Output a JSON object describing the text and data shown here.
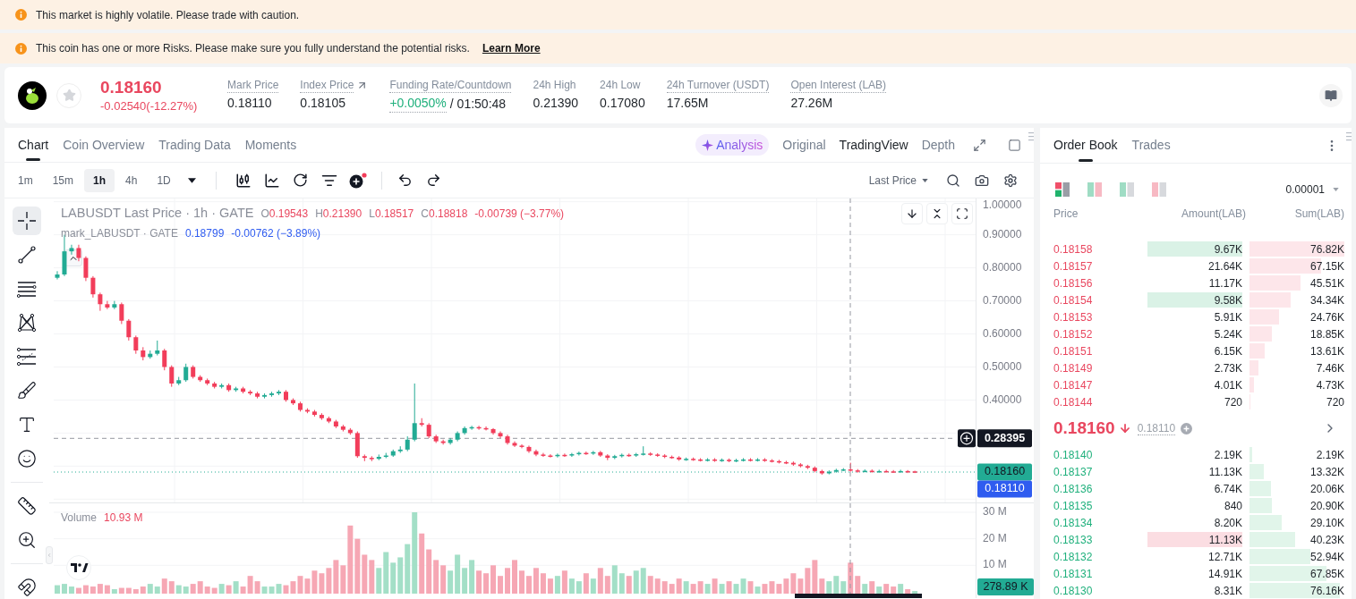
{
  "banners": [
    {
      "text": "This market is highly volatile. Please trade with caution."
    },
    {
      "text": "This coin has one or more Risks. Please make sure you fully understand the potential risks.",
      "link": "Learn More"
    }
  ],
  "ticker": {
    "favorited": false,
    "last_price": "0.18160",
    "change": "-0.02540(-12.27%)",
    "falling": true,
    "stats": [
      {
        "kind": "plain",
        "label": "Mark Price",
        "value": "0.18110",
        "dotted": true
      },
      {
        "kind": "link",
        "label": "Index Price",
        "value": "0.18105",
        "dotted": true
      },
      {
        "kind": "funding",
        "label": "Funding Rate/Countdown",
        "value": "+0.0050%",
        "countdown": "/ 01:50:48",
        "dotted": true
      },
      {
        "kind": "plain",
        "label": "24h High",
        "value": "0.21390",
        "dotted": false
      },
      {
        "kind": "plain",
        "label": "24h Low",
        "value": "0.17080",
        "dotted": false
      },
      {
        "kind": "plain",
        "label": "24h Turnover (USDT)",
        "value": "17.65M",
        "dotted": true
      },
      {
        "kind": "plain",
        "label": "Open Interest (LAB)",
        "value": "27.26M",
        "dotted": true
      }
    ]
  },
  "chart_panel": {
    "tabs": [
      {
        "label": "Chart",
        "selected": true
      },
      {
        "label": "Coin Overview",
        "selected": false
      },
      {
        "label": "Trading Data",
        "selected": false
      },
      {
        "label": "Moments",
        "selected": false
      }
    ],
    "views": [
      {
        "kind": "ai",
        "label": "Analysis",
        "selected": false
      },
      {
        "kind": "plain",
        "label": "Original",
        "selected": false
      },
      {
        "kind": "plain",
        "label": "TradingView",
        "selected": true
      },
      {
        "kind": "plain",
        "label": "Depth",
        "selected": false
      }
    ],
    "intervals": [
      {
        "label": "1m",
        "selected": false
      },
      {
        "label": "15m",
        "selected": false
      },
      {
        "label": "1h",
        "selected": true
      },
      {
        "label": "4h",
        "selected": false
      },
      {
        "label": "1D",
        "selected": false
      }
    ],
    "price_source": "Last Price",
    "tool_groups": [
      [
        {
          "kind": "crosshair",
          "selected": true
        },
        {
          "kind": "trend-line",
          "selected": false
        },
        {
          "kind": "horizontal-lines",
          "selected": false
        },
        {
          "kind": "pattern",
          "selected": false
        },
        {
          "kind": "levels",
          "selected": false
        },
        {
          "kind": "brush",
          "selected": false
        },
        {
          "kind": "text",
          "selected": false
        },
        {
          "kind": "emoji",
          "selected": false
        }
      ],
      [
        {
          "kind": "ruler",
          "selected": false
        },
        {
          "kind": "zoom",
          "selected": false
        }
      ],
      [
        {
          "kind": "magnet",
          "selected": false
        }
      ]
    ],
    "legend": {
      "title": "LABUSDT Last Price · 1h · GATE",
      "ohlc": [
        {
          "key": "O",
          "value": "0.19543"
        },
        {
          "key": "H",
          "value": "0.21390"
        },
        {
          "key": "L",
          "value": "0.18517"
        },
        {
          "key": "C",
          "value": "0.18818"
        }
      ],
      "change": "-0.00739 (−3.77%)"
    },
    "mark_legend": {
      "title": "mark_LABUSDT · GATE",
      "value": "0.18799",
      "change": "-0.00762 (−3.89%)"
    },
    "price_pane": {
      "crosshair_price": "0.28395",
      "last_price": "0.18160",
      "mark_price": "0.18110",
      "chart_data": {
        "type": "candlestick",
        "grid": true,
        "ylim": [
          0.09,
          1.01
        ],
        "yticks": [
          {
            "value": 0.4,
            "label": "0.40000"
          },
          {
            "value": 0.5,
            "label": "0.50000"
          },
          {
            "value": 0.6,
            "label": "0.60000"
          },
          {
            "value": 0.7,
            "label": "0.70000"
          },
          {
            "value": 0.8,
            "label": "0.80000"
          },
          {
            "value": 0.9,
            "label": "0.90000"
          },
          {
            "value": 1.0,
            "label": "1.00000"
          }
        ],
        "categories": [
          null,
          null,
          null,
          null,
          null,
          null,
          null,
          null,
          null,
          null,
          null,
          null,
          null,
          null,
          null,
          null,
          null,
          null,
          null,
          null,
          null,
          null,
          null,
          null,
          null,
          null,
          null,
          null,
          null,
          null,
          null,
          null,
          null,
          null,
          null,
          null,
          null,
          null,
          null,
          null,
          null,
          null,
          null,
          null,
          null,
          null,
          null,
          null,
          null,
          null,
          null,
          null,
          null,
          null,
          null,
          null,
          null,
          null,
          null,
          null,
          null,
          null,
          null,
          null,
          null,
          null,
          null,
          null,
          null,
          null,
          null,
          null,
          null,
          null,
          null,
          null,
          null,
          null,
          null,
          null,
          null,
          null,
          null,
          null,
          null,
          null,
          null,
          null,
          null,
          null,
          null,
          null,
          null,
          null,
          null,
          null,
          null,
          null,
          null,
          null,
          null,
          null,
          null,
          null,
          null,
          null,
          null,
          null,
          null,
          null,
          null,
          null,
          null,
          null,
          null,
          null,
          null,
          null,
          null,
          null,
          null,
          null,
          null,
          null,
          null,
          null,
          null,
          null,
          null
        ],
        "ohlc": [
          [
            0.77,
            0.79,
            0.765,
            0.78
          ],
          [
            0.78,
            0.9,
            0.775,
            0.85
          ],
          [
            0.85,
            0.87,
            0.84,
            0.86
          ],
          [
            0.86,
            0.87,
            0.82,
            0.83
          ],
          [
            0.83,
            0.835,
            0.76,
            0.77
          ],
          [
            0.77,
            0.775,
            0.71,
            0.72
          ],
          [
            0.72,
            0.725,
            0.67,
            0.69
          ],
          [
            0.69,
            0.7,
            0.675,
            0.68
          ],
          [
            0.68,
            0.7,
            0.675,
            0.69
          ],
          [
            0.69,
            0.695,
            0.63,
            0.64
          ],
          [
            0.64,
            0.645,
            0.58,
            0.59
          ],
          [
            0.59,
            0.595,
            0.54,
            0.55
          ],
          [
            0.55,
            0.56,
            0.52,
            0.53
          ],
          [
            0.53,
            0.55,
            0.525,
            0.54
          ],
          [
            0.54,
            0.58,
            0.535,
            0.55
          ],
          [
            0.55,
            0.555,
            0.49,
            0.5
          ],
          [
            0.5,
            0.505,
            0.44,
            0.45
          ],
          [
            0.45,
            0.47,
            0.445,
            0.46
          ],
          [
            0.46,
            0.51,
            0.455,
            0.5
          ],
          [
            0.5,
            0.505,
            0.465,
            0.47
          ],
          [
            0.47,
            0.475,
            0.455,
            0.46
          ],
          [
            0.46,
            0.465,
            0.445,
            0.45
          ],
          [
            0.45,
            0.455,
            0.435,
            0.44
          ],
          [
            0.44,
            0.45,
            0.435,
            0.445
          ],
          [
            0.445,
            0.45,
            0.425,
            0.43
          ],
          [
            0.43,
            0.44,
            0.425,
            0.435
          ],
          [
            0.435,
            0.44,
            0.42,
            0.425
          ],
          [
            0.425,
            0.43,
            0.415,
            0.42
          ],
          [
            0.42,
            0.425,
            0.405,
            0.41
          ],
          [
            0.41,
            0.42,
            0.405,
            0.415
          ],
          [
            0.415,
            0.425,
            0.41,
            0.42
          ],
          [
            0.42,
            0.43,
            0.415,
            0.425
          ],
          [
            0.425,
            0.43,
            0.395,
            0.4
          ],
          [
            0.4,
            0.405,
            0.385,
            0.39
          ],
          [
            0.39,
            0.395,
            0.365,
            0.37
          ],
          [
            0.37,
            0.375,
            0.36,
            0.365
          ],
          [
            0.365,
            0.37,
            0.35,
            0.355
          ],
          [
            0.355,
            0.36,
            0.34,
            0.345
          ],
          [
            0.345,
            0.35,
            0.33,
            0.335
          ],
          [
            0.335,
            0.34,
            0.315,
            0.32
          ],
          [
            0.32,
            0.325,
            0.305,
            0.31
          ],
          [
            0.31,
            0.315,
            0.295,
            0.3
          ],
          [
            0.3,
            0.305,
            0.225,
            0.23
          ],
          [
            0.23,
            0.235,
            0.215,
            0.225
          ],
          [
            0.225,
            0.23,
            0.215,
            0.222
          ],
          [
            0.222,
            0.235,
            0.218,
            0.228
          ],
          [
            0.228,
            0.24,
            0.224,
            0.232
          ],
          [
            0.232,
            0.25,
            0.228,
            0.245
          ],
          [
            0.245,
            0.26,
            0.24,
            0.25
          ],
          [
            0.25,
            0.29,
            0.245,
            0.28
          ],
          [
            0.28,
            0.45,
            0.275,
            0.33
          ],
          [
            0.33,
            0.345,
            0.32,
            0.325
          ],
          [
            0.325,
            0.33,
            0.285,
            0.29
          ],
          [
            0.29,
            0.295,
            0.27,
            0.275
          ],
          [
            0.275,
            0.28,
            0.265,
            0.27
          ],
          [
            0.27,
            0.285,
            0.265,
            0.28
          ],
          [
            0.28,
            0.305,
            0.275,
            0.3
          ],
          [
            0.3,
            0.32,
            0.295,
            0.315
          ],
          [
            0.315,
            0.322,
            0.31,
            0.318
          ],
          [
            0.318,
            0.322,
            0.31,
            0.315
          ],
          [
            0.315,
            0.32,
            0.308,
            0.312
          ],
          [
            0.312,
            0.315,
            0.295,
            0.3
          ],
          [
            0.3,
            0.305,
            0.285,
            0.29
          ],
          [
            0.29,
            0.295,
            0.265,
            0.27
          ],
          [
            0.27,
            0.275,
            0.258,
            0.262
          ],
          [
            0.262,
            0.266,
            0.254,
            0.258
          ],
          [
            0.258,
            0.262,
            0.24,
            0.245
          ],
          [
            0.245,
            0.25,
            0.23,
            0.235
          ],
          [
            0.235,
            0.24,
            0.228,
            0.232
          ],
          [
            0.232,
            0.236,
            0.226,
            0.23
          ],
          [
            0.23,
            0.238,
            0.226,
            0.234
          ],
          [
            0.234,
            0.238,
            0.228,
            0.232
          ],
          [
            0.232,
            0.24,
            0.228,
            0.236
          ],
          [
            0.236,
            0.244,
            0.232,
            0.24
          ],
          [
            0.24,
            0.244,
            0.234,
            0.238
          ],
          [
            0.238,
            0.246,
            0.234,
            0.242
          ],
          [
            0.242,
            0.246,
            0.228,
            0.232
          ],
          [
            0.232,
            0.236,
            0.218,
            0.225
          ],
          [
            0.225,
            0.234,
            0.221,
            0.23
          ],
          [
            0.23,
            0.238,
            0.226,
            0.234
          ],
          [
            0.234,
            0.238,
            0.228,
            0.232
          ],
          [
            0.232,
            0.24,
            0.228,
            0.236
          ],
          [
            0.236,
            0.26,
            0.232,
            0.238
          ],
          [
            0.238,
            0.242,
            0.231,
            0.235
          ],
          [
            0.235,
            0.239,
            0.228,
            0.232
          ],
          [
            0.232,
            0.236,
            0.224,
            0.228
          ],
          [
            0.228,
            0.232,
            0.222,
            0.226
          ],
          [
            0.226,
            0.23,
            0.216,
            0.22
          ],
          [
            0.22,
            0.226,
            0.216,
            0.222
          ],
          [
            0.222,
            0.226,
            0.216,
            0.22
          ],
          [
            0.22,
            0.224,
            0.214,
            0.218
          ],
          [
            0.218,
            0.224,
            0.214,
            0.22
          ],
          [
            0.22,
            0.224,
            0.213,
            0.217
          ],
          [
            0.217,
            0.223,
            0.213,
            0.219
          ],
          [
            0.219,
            0.223,
            0.212,
            0.216
          ],
          [
            0.216,
            0.222,
            0.212,
            0.218
          ],
          [
            0.218,
            0.224,
            0.214,
            0.22
          ],
          [
            0.22,
            0.224,
            0.214,
            0.218
          ],
          [
            0.218,
            0.224,
            0.214,
            0.22
          ],
          [
            0.22,
            0.224,
            0.213,
            0.217
          ],
          [
            0.217,
            0.221,
            0.211,
            0.215
          ],
          [
            0.215,
            0.219,
            0.208,
            0.212
          ],
          [
            0.212,
            0.216,
            0.206,
            0.21
          ],
          [
            0.21,
            0.214,
            0.201,
            0.205
          ],
          [
            0.205,
            0.209,
            0.196,
            0.2
          ],
          [
            0.2,
            0.204,
            0.191,
            0.195
          ],
          [
            0.195,
            0.199,
            0.181,
            0.185
          ],
          [
            0.185,
            0.189,
            0.174,
            0.178
          ],
          [
            0.178,
            0.187,
            0.175,
            0.183
          ],
          [
            0.183,
            0.192,
            0.18,
            0.188
          ],
          [
            0.188,
            0.194,
            0.185,
            0.19
          ],
          [
            0.19,
            0.21,
            0.183,
            0.187
          ],
          [
            0.187,
            0.191,
            0.18,
            0.184
          ],
          [
            0.184,
            0.19,
            0.181,
            0.186
          ],
          [
            0.186,
            0.19,
            0.18,
            0.183
          ],
          [
            0.183,
            0.189,
            0.18,
            0.185
          ],
          [
            0.185,
            0.189,
            0.181,
            0.184
          ],
          [
            0.184,
            0.188,
            0.18,
            0.183
          ],
          [
            0.183,
            0.189,
            0.18,
            0.185
          ],
          [
            0.185,
            0.188,
            0.179,
            0.182
          ],
          [
            0.184,
            0.186,
            0.179,
            0.182
          ],
          null,
          null,
          null,
          null,
          null,
          null,
          null,
          null
        ],
        "ref_lines": [
          {
            "axis": "y",
            "value": 0.182,
            "color": "#22ab94"
          },
          {
            "axis": "y",
            "value": 0.284,
            "color": "#9598a1"
          }
        ]
      }
    },
    "volume_pane": {
      "label": "Volume",
      "value": "10.93 M",
      "current": "278.89 K",
      "chart_data": {
        "type": "bar",
        "stacked": true,
        "grid": true,
        "ylim": [
          0,
          33.7
        ],
        "yticks": [
          {
            "value": 10,
            "label": "10 M"
          },
          {
            "value": 20,
            "label": "20 M"
          },
          {
            "value": 30,
            "label": "30 M"
          }
        ],
        "categories": [
          null,
          null,
          null,
          null,
          null,
          null,
          null,
          null,
          null,
          null,
          null,
          null,
          null,
          null,
          null,
          null,
          null,
          null,
          null,
          null,
          null,
          null,
          null,
          null,
          null,
          null,
          null,
          null,
          null,
          null,
          null,
          null,
          null,
          null,
          null,
          null,
          null,
          null,
          null,
          null,
          null,
          null,
          null,
          null,
          null,
          null,
          null,
          null,
          null,
          null,
          null,
          null,
          null,
          null,
          null,
          null,
          null,
          null,
          null,
          null,
          null,
          null,
          null,
          null,
          null,
          null,
          null,
          null,
          null,
          null,
          null,
          null,
          null,
          null,
          null,
          null,
          null,
          null,
          null,
          null,
          null,
          null,
          null,
          null,
          null,
          null,
          null,
          null,
          null,
          null,
          null,
          null,
          null,
          null,
          null,
          null,
          null,
          null,
          null,
          null,
          null,
          null,
          null,
          null,
          null,
          null,
          null,
          null,
          null,
          null,
          null,
          null,
          null,
          null,
          null,
          null,
          null,
          null,
          null,
          null,
          null,
          null,
          null,
          null,
          null,
          null,
          null,
          null,
          null
        ],
        "series": [
          {
            "color": "#a3dfc7",
            "values": [
              2.5,
              3,
              2,
              null,
              null,
              null,
              null,
              null,
              1,
              null,
              null,
              null,
              null,
              3,
              2,
              null,
              null,
              2.5,
              2,
              null,
              null,
              null,
              null,
              3,
              null,
              4,
              null,
              null,
              null,
              2,
              2,
              3,
              null,
              null,
              null,
              null,
              null,
              null,
              null,
              null,
              null,
              null,
              null,
              null,
              null,
              9,
              15,
              11,
              13,
              18,
              30,
              null,
              null,
              null,
              null,
              8,
              14,
              9,
              12,
              null,
              null,
              null,
              null,
              null,
              null,
              null,
              null,
              null,
              null,
              null,
              6,
              null,
              5,
              4,
              null,
              5,
              null,
              null,
              10,
              7,
              null,
              8,
              9,
              null,
              null,
              null,
              null,
              null,
              4,
              null,
              null,
              3,
              null,
              3,
              null,
              3,
              5,
              null,
              2,
              null,
              null,
              null,
              null,
              null,
              null,
              null,
              null,
              null,
              4,
              6,
              4,
              null,
              null,
              3,
              null,
              2,
              null,
              null,
              3,
              null,
              0.3,
              null,
              null,
              null,
              null,
              null,
              null,
              null,
              null
            ]
          },
          {
            "color": "#f6a7b4",
            "values": [
              null,
              null,
              null,
              1.5,
              2.5,
              2,
              3,
              2.5,
              null,
              1.5,
              1.5,
              1,
              2,
              null,
              null,
              5,
              4,
              null,
              null,
              3,
              4,
              2,
              1.5,
              null,
              2.5,
              null,
              2,
              6,
              4,
              null,
              null,
              null,
              2.5,
              4,
              6,
              5,
              8,
              7,
              9,
              12,
              10,
              25,
              20,
              14,
              12,
              null,
              null,
              null,
              null,
              null,
              null,
              22,
              16,
              12,
              10,
              null,
              null,
              null,
              null,
              8,
              7,
              10,
              6,
              9,
              12,
              8,
              6,
              9,
              7,
              5,
              null,
              8,
              null,
              null,
              7,
              null,
              9,
              6,
              null,
              null,
              6,
              null,
              null,
              6,
              5,
              4,
              3,
              5,
              null,
              3,
              4,
              null,
              5,
              null,
              4,
              null,
              null,
              4,
              null,
              3,
              4,
              3,
              5,
              7,
              5,
              9,
              12,
              5,
              null,
              null,
              null,
              11,
              6,
              null,
              4,
              null,
              3,
              2,
              null,
              1,
              null,
              null,
              null,
              null,
              null,
              null,
              null,
              null,
              null
            ]
          }
        ]
      }
    }
  },
  "order_book": {
    "tabs": [
      {
        "label": "Order Book",
        "selected": true
      },
      {
        "label": "Trades",
        "selected": false
      }
    ],
    "layouts": [
      {
        "kind": "split",
        "selected": true
      },
      {
        "kind": "mixed",
        "selected": false
      },
      {
        "kind": "bids",
        "selected": false
      },
      {
        "kind": "asks",
        "selected": false
      }
    ],
    "precision": "0.00001",
    "columns": [
      "Price",
      "Amount(LAB)",
      "Sum(LAB)"
    ],
    "asks": [
      {
        "price": "0.18158",
        "amount": "9.67K",
        "sum": "76.82K",
        "level": 1.0,
        "highlighted": true
      },
      {
        "price": "0.18157",
        "amount": "21.64K",
        "sum": "67.15K",
        "level": 0.75,
        "highlighted": false
      },
      {
        "price": "0.18156",
        "amount": "11.17K",
        "sum": "45.51K",
        "level": 0.54,
        "highlighted": false
      },
      {
        "price": "0.18154",
        "amount": "9.58K",
        "sum": "34.34K",
        "level": 0.43,
        "highlighted": true
      },
      {
        "price": "0.18153",
        "amount": "5.91K",
        "sum": "24.76K",
        "level": 0.31,
        "highlighted": false
      },
      {
        "price": "0.18152",
        "amount": "5.24K",
        "sum": "18.85K",
        "level": 0.24,
        "highlighted": false
      },
      {
        "price": "0.18151",
        "amount": "6.15K",
        "sum": "13.61K",
        "level": 0.16,
        "highlighted": false
      },
      {
        "price": "0.18149",
        "amount": "2.73K",
        "sum": "7.46K",
        "level": 0.09,
        "highlighted": false
      },
      {
        "price": "0.18147",
        "amount": "4.01K",
        "sum": "4.73K",
        "level": 0.05,
        "highlighted": false
      },
      {
        "price": "0.18144",
        "amount": "720",
        "sum": "720",
        "level": 0.01,
        "highlighted": false
      }
    ],
    "mid": {
      "price": "0.18160",
      "falling": true,
      "mark": "0.18110"
    },
    "bids": [
      {
        "price": "0.18140",
        "amount": "2.19K",
        "sum": "2.19K",
        "level": 0.03,
        "highlighted": false
      },
      {
        "price": "0.18137",
        "amount": "11.13K",
        "sum": "13.32K",
        "level": 0.15,
        "highlighted": false
      },
      {
        "price": "0.18136",
        "amount": "6.74K",
        "sum": "20.06K",
        "level": 0.23,
        "highlighted": false
      },
      {
        "price": "0.18135",
        "amount": "840",
        "sum": "20.90K",
        "level": 0.24,
        "highlighted": false
      },
      {
        "price": "0.18134",
        "amount": "8.20K",
        "sum": "29.10K",
        "level": 0.34,
        "highlighted": false
      },
      {
        "price": "0.18133",
        "amount": "11.13K",
        "sum": "40.23K",
        "level": 0.48,
        "highlighted": true
      },
      {
        "price": "0.18132",
        "amount": "12.71K",
        "sum": "52.94K",
        "level": 0.64,
        "highlighted": false
      },
      {
        "price": "0.18131",
        "amount": "14.91K",
        "sum": "67.85K",
        "level": 0.81,
        "highlighted": false
      },
      {
        "price": "0.18130",
        "amount": "8.31K",
        "sum": "76.16K",
        "level": 0.95,
        "highlighted": false
      }
    ]
  }
}
